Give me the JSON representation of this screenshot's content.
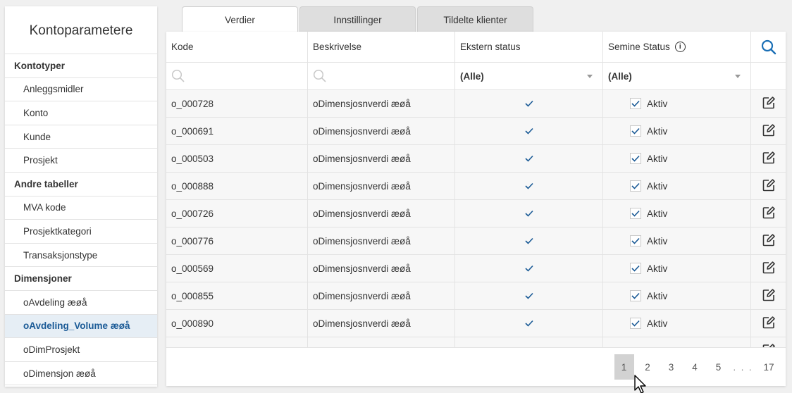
{
  "sidebar": {
    "title": "Kontoparametere",
    "groups": [
      {
        "label": "Kontotyper",
        "items": [
          "Anleggsmidler",
          "Konto",
          "Kunde",
          "Prosjekt"
        ]
      },
      {
        "label": "Andre tabeller",
        "items": [
          "MVA kode",
          "Prosjektkategori",
          "Transaksjonstype"
        ]
      },
      {
        "label": "Dimensjoner",
        "items": [
          "oAvdeling æøå",
          "oAvdeling_Volume æøå",
          "oDimProsjekt",
          "oDimensjon æøå"
        ]
      }
    ],
    "active_item": "oAvdeling_Volume æøå"
  },
  "tabs": [
    {
      "label": "Verdier",
      "active": true
    },
    {
      "label": "Innstillinger",
      "active": false
    },
    {
      "label": "Tildelte klienter",
      "active": false
    }
  ],
  "table": {
    "headers": {
      "code": "Kode",
      "description": "Beskrivelse",
      "external_status": "Ekstern status",
      "semine_status": "Semine Status"
    },
    "filters": {
      "external_status": "(Alle)",
      "semine_status": "(Alle)"
    },
    "rows": [
      {
        "code": "o_000728",
        "description": "oDimensjosnverdi æøå",
        "external": true,
        "status": "Aktiv"
      },
      {
        "code": "o_000691",
        "description": "oDimensjosnverdi æøå",
        "external": true,
        "status": "Aktiv"
      },
      {
        "code": "o_000503",
        "description": "oDimensjosnverdi æøå",
        "external": true,
        "status": "Aktiv"
      },
      {
        "code": "o_000888",
        "description": "oDimensjosnverdi æøå",
        "external": true,
        "status": "Aktiv"
      },
      {
        "code": "o_000726",
        "description": "oDimensjosnverdi æøå",
        "external": true,
        "status": "Aktiv"
      },
      {
        "code": "o_000776",
        "description": "oDimensjosnverdi æøå",
        "external": true,
        "status": "Aktiv"
      },
      {
        "code": "o_000569",
        "description": "oDimensjosnverdi æøå",
        "external": true,
        "status": "Aktiv"
      },
      {
        "code": "o_000855",
        "description": "oDimensjosnverdi æøå",
        "external": true,
        "status": "Aktiv"
      },
      {
        "code": "o_000890",
        "description": "oDimensjosnverdi æøå",
        "external": true,
        "status": "Aktiv"
      },
      {
        "code": "",
        "description": "",
        "external": false,
        "status": ""
      }
    ]
  },
  "pagination": {
    "pages": [
      "1",
      "2",
      "3",
      "4",
      "5"
    ],
    "current": "1",
    "ellipsis": ". . .",
    "last": "17"
  },
  "colors": {
    "accent": "#1a5a96",
    "active_bg": "#e6eef5",
    "search_icon": "#1a6fb5"
  },
  "icons": {
    "search": "search-icon",
    "info": "info-icon",
    "edit": "edit-icon",
    "check": "check-icon",
    "dropdown": "chevron-down-icon"
  }
}
